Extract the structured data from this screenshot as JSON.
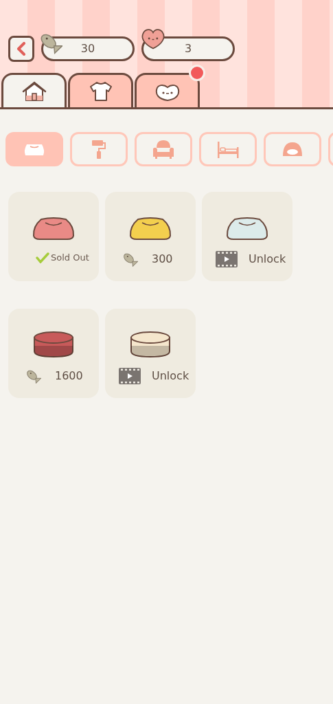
{
  "currencies": [
    {
      "kind": "fish",
      "value": "30"
    },
    {
      "kind": "heart",
      "value": "3"
    }
  ],
  "tabs": [
    {
      "kind": "house",
      "selected": true,
      "badge": false
    },
    {
      "kind": "shirt",
      "selected": false,
      "badge": false
    },
    {
      "kind": "heart-face",
      "selected": false,
      "badge": true
    }
  ],
  "categories": [
    {
      "kind": "bowl",
      "selected": true
    },
    {
      "kind": "roller",
      "selected": false
    },
    {
      "kind": "armchair",
      "selected": false
    },
    {
      "kind": "bed",
      "selected": false
    },
    {
      "kind": "cushion",
      "selected": false
    },
    {
      "kind": "other",
      "selected": false
    }
  ],
  "items": [
    {
      "color": "#e98a86",
      "kind": "sold_out",
      "label": "Sold Out"
    },
    {
      "color": "#f3cf4e",
      "kind": "price",
      "label": "300"
    },
    {
      "color": "#dcebea",
      "kind": "ad",
      "label": "Unlock"
    },
    {
      "color": "#c85a5a",
      "kind": "price",
      "label": "1600"
    },
    {
      "color": "#f5e6cc",
      "kind": "ad",
      "label": "Unlock"
    }
  ]
}
